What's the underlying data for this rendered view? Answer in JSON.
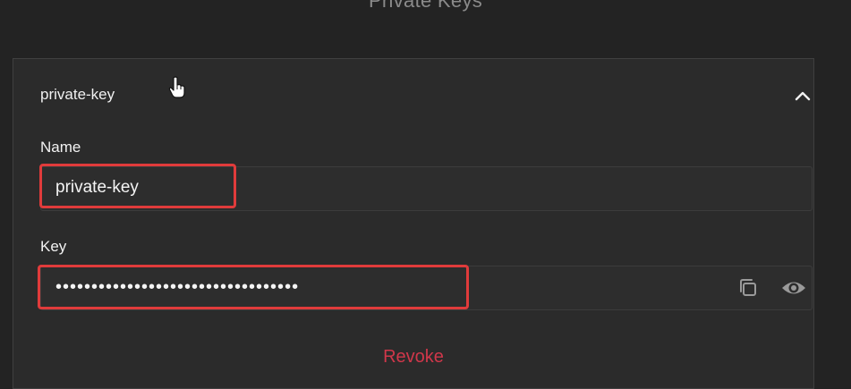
{
  "page": {
    "title": "Private Keys"
  },
  "card": {
    "title": "private-key",
    "collapse_icon": "chevron-up-icon"
  },
  "name_field": {
    "label": "Name",
    "value": "private-key"
  },
  "key_field": {
    "label": "Key",
    "value": "••••••••••••••••••••••••••••••••••",
    "copy_icon": "copy-icon",
    "reveal_icon": "eye-icon"
  },
  "actions": {
    "revoke_label": "Revoke"
  },
  "colors": {
    "background": "#232323",
    "card": "#2b2b2b",
    "highlight": "#e03b3b",
    "danger": "#d0374a"
  }
}
